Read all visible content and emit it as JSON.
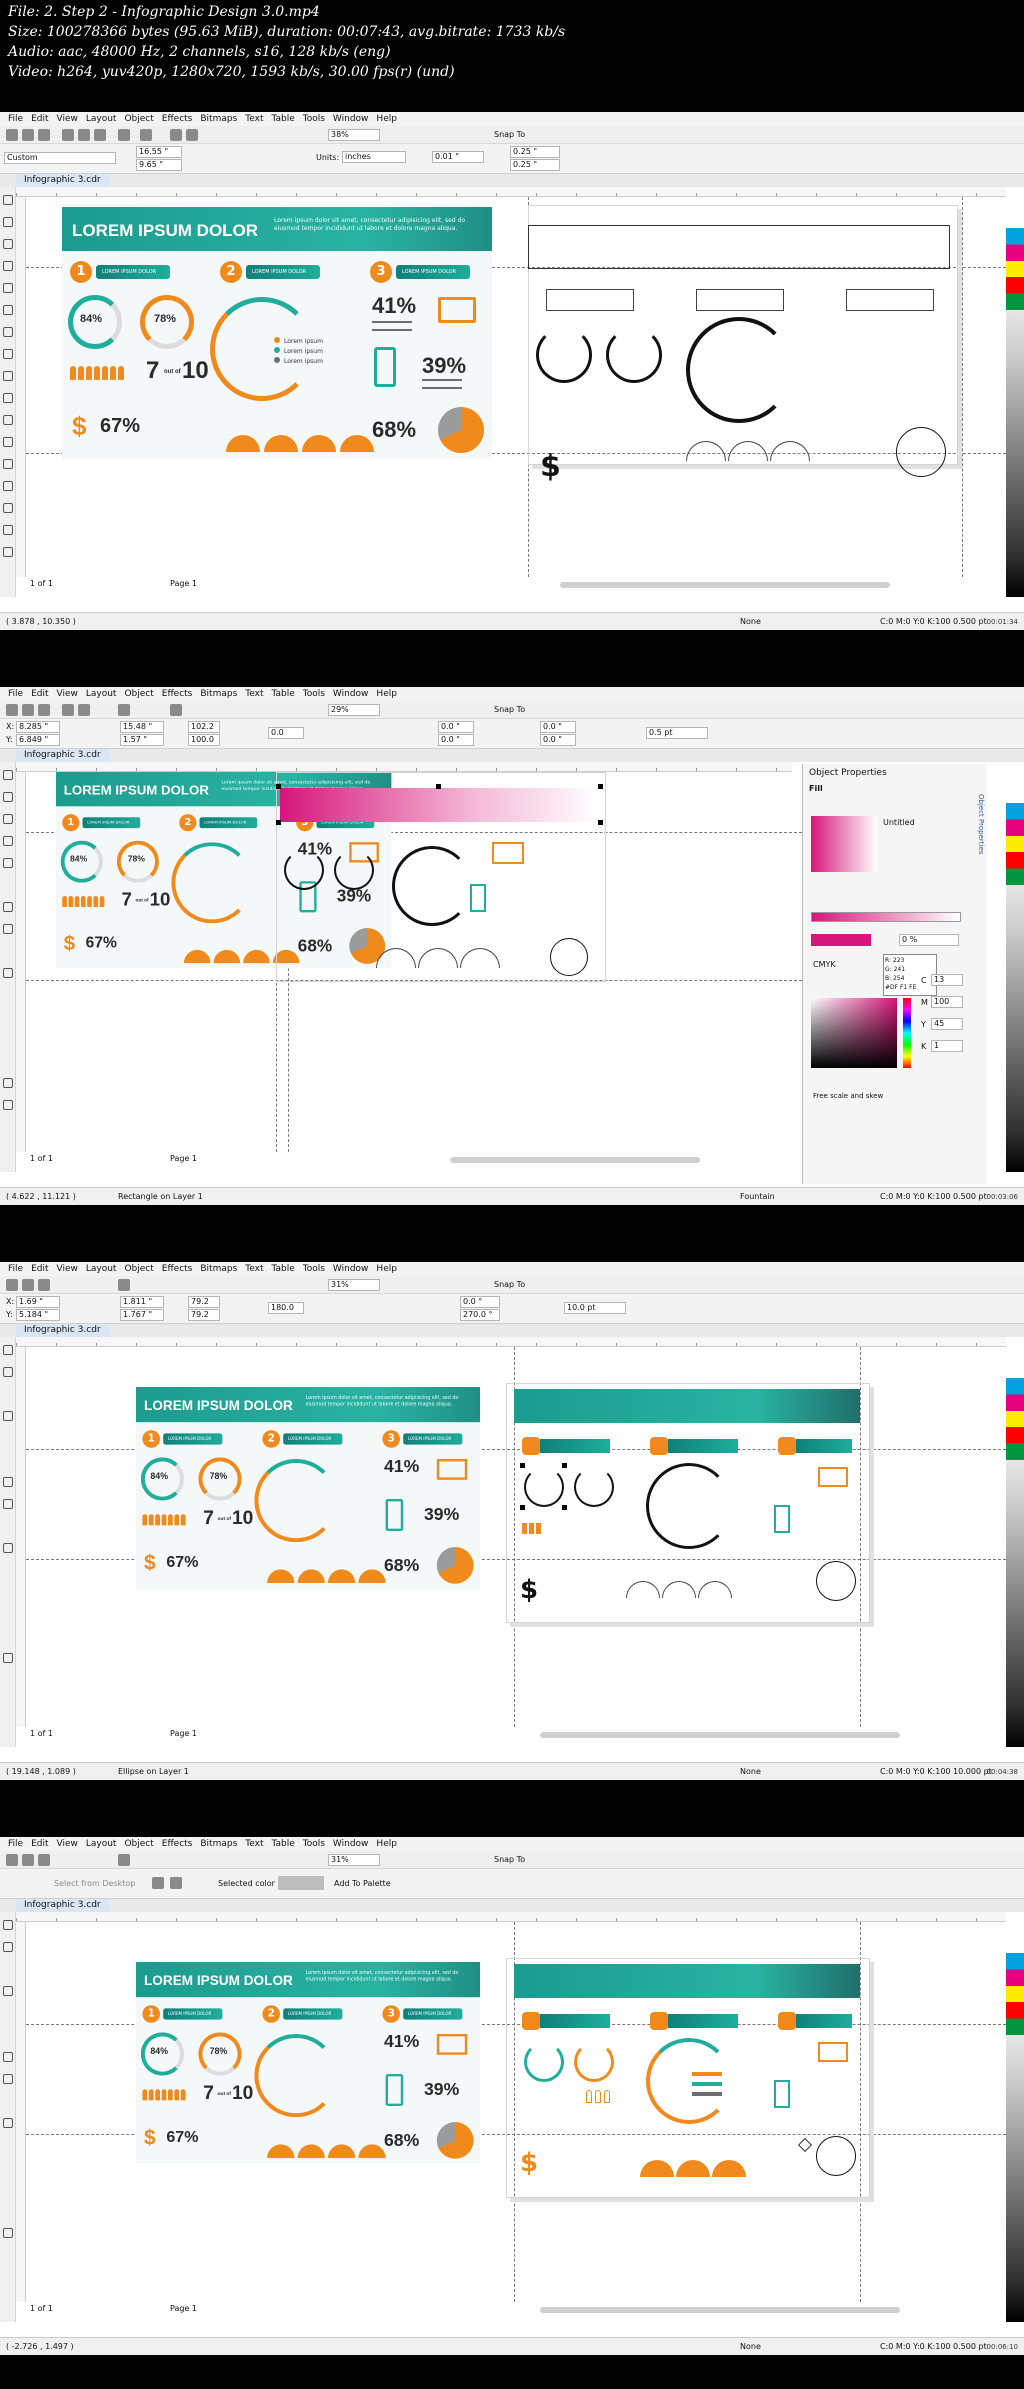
{
  "header": {
    "lines": [
      "File: 2. Step 2 - Infographic Design 3.0.mp4",
      "Size: 100278366 bytes (95.63 MiB), duration: 00:07:43, avg.bitrate: 1733 kb/s",
      "Audio: aac, 48000 Hz, 2 channels, s16, 128 kb/s (eng)",
      "Video: h264, yuv420p, 1280x720, 1593 kb/s, 30.00 fps(r) (und)"
    ]
  },
  "app": {
    "menu": [
      "File",
      "Edit",
      "View",
      "Layout",
      "Object",
      "Effects",
      "Bitmaps",
      "Text",
      "Table",
      "Tools",
      "Window",
      "Help"
    ],
    "doc_tab": "Infographic 3.cdr",
    "snap_label": "Snap To",
    "page_count": "1 of 1",
    "page_label": "Page 1"
  },
  "infographic": {
    "title": "LOREM IPSUM DOLOR",
    "subtitle": "Lorem ipsum dolor sit amet, consectetur adipisicing elit, sed do eiusmod tempor incididunt ut labore et dolore magna aliqua.",
    "numbers": [
      "1",
      "2",
      "3"
    ],
    "pill_text": "LOREM IPSUM DOLOR",
    "stat_84": "84%",
    "stat_78": "78%",
    "stat_41": "41%",
    "stat_39": "39%",
    "stat_7": "7",
    "stat_out": "out of",
    "stat_10": "10",
    "stat_67": "67%",
    "stat_68": "68%",
    "dollar": "$",
    "legend": [
      "Lorem ipsum",
      "Lorem ipsum",
      "Lorem ipsum"
    ]
  },
  "frames": [
    {
      "timestamp": "00:01:34",
      "zoom": "38%",
      "preset": "Custom",
      "width": "16.55 \"",
      "height": "9.65 \"",
      "units_label": "Units:",
      "units": "inches",
      "nudge": "0.01 \"",
      "dup_x": "0.25 \"",
      "dup_y": "0.25 \"",
      "coords": "( 3.878 , 10.350 )",
      "status_object": "",
      "fill_label": "None",
      "outline": "C:0 M:0 Y:0 K:100  0.500 pt"
    },
    {
      "timestamp": "00:03:06",
      "zoom": "29%",
      "x": "8.285 \"",
      "y": "6.849 \"",
      "w": "15.48 \"",
      "h": "1.57 \"",
      "sx": "102.2",
      "sy": "100.0",
      "angle": "0.0",
      "corner1": "0.0 \"",
      "corner2": "0.0 \"",
      "corner3": "0.0 \"",
      "corner4": "0.0 \"",
      "outline_w": "0.5 pt",
      "coords": "( 4.622 , 11.121 )",
      "status_object": "Rectangle on Layer 1",
      "fill_label": "Fountain",
      "outline": "C:0 M:0 Y:0 K:100  0.500 pt",
      "docker": {
        "title": "Object Properties",
        "fill_label": "Fill",
        "gradient_name": "Untitled",
        "color_model": "CMYK",
        "opacity": "0 %",
        "c": "13",
        "m": "100",
        "y": "45",
        "k": "1",
        "rgb_r": "R: 223",
        "rgb_g": "G: 241",
        "rgb_b": "B: 254",
        "hex": "#DF F1 FE",
        "free_scale": "Free scale and skew",
        "tab_label": "Object Properties"
      }
    },
    {
      "timestamp": "00:04:38",
      "zoom": "31%",
      "x": "1.69 \"",
      "y": "5.184 \"",
      "w": "1.811 \"",
      "h": "1.767 \"",
      "sx": "79.2",
      "sy": "79.2",
      "angle": "180.0",
      "arc_start": "0.0 °",
      "arc_end": "270.0 °",
      "outline_w": "10.0 pt",
      "coords": "( 19.148 , 1.089 )",
      "status_object": "Ellipse on Layer 1",
      "fill_label": "None",
      "outline": "C:0 M:0 Y:0 K:100  10.000 pt"
    },
    {
      "timestamp": "00:06:10",
      "zoom": "31%",
      "select_desktop": "Select from Desktop",
      "selected_color": "Selected color",
      "add_palette": "Add To Palette",
      "coords": "( -2.726 , 1.497 )",
      "status_object": "",
      "fill_label": "None",
      "outline": "C:0 M:0 Y:0 K:100  0.500 pt"
    }
  ],
  "colors": {
    "teal": "#1c9b8f",
    "orange": "#f18a1d",
    "magenta": "#d6167a",
    "dark": "#111111"
  }
}
